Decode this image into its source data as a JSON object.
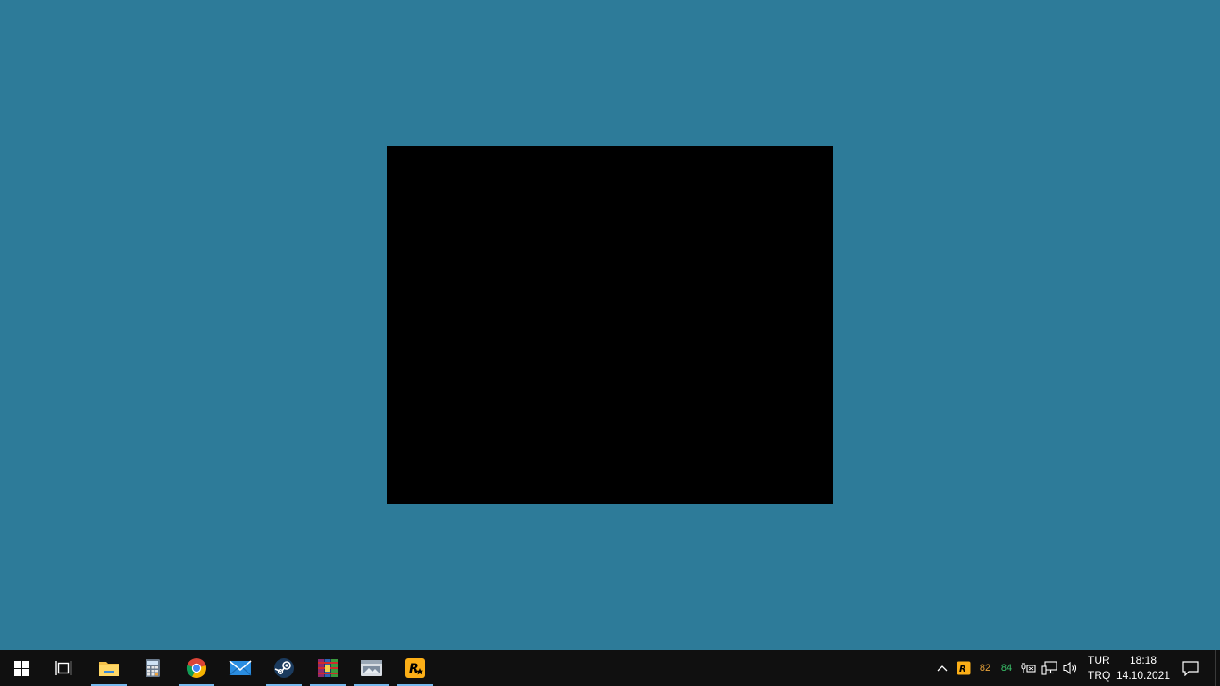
{
  "desktop": {
    "background_color": "#2d7b99"
  },
  "taskbar": {
    "background_color": "#101010",
    "pinned_apps": [
      {
        "name": "file-explorer",
        "icon": "folder-icon"
      },
      {
        "name": "calculator",
        "icon": "calculator-icon"
      },
      {
        "name": "google-chrome",
        "icon": "chrome-icon"
      },
      {
        "name": "mail",
        "icon": "mail-icon"
      },
      {
        "name": "steam",
        "icon": "steam-icon"
      },
      {
        "name": "winrar",
        "icon": "winrar-icon"
      },
      {
        "name": "app-window",
        "icon": "window-app-icon"
      },
      {
        "name": "rockstar-launcher",
        "icon": "rockstar-icon"
      }
    ],
    "tray": {
      "temp_1": "82",
      "temp_2": "84",
      "temp_1_color": "#e8a33a",
      "temp_2_color": "#3ac46b",
      "language_top": "TUR",
      "language_bottom": "TRQ",
      "time": "18:18",
      "date": "14.10.2021"
    }
  }
}
